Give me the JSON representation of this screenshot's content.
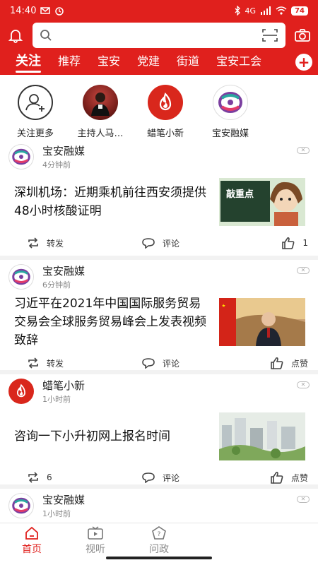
{
  "status_bar": {
    "time": "14:40",
    "network": "4G",
    "battery": "74"
  },
  "search": {
    "placeholder": ""
  },
  "tabs": [
    {
      "label": "关注",
      "active": true
    },
    {
      "label": "推荐"
    },
    {
      "label": "宝安"
    },
    {
      "label": "党建"
    },
    {
      "label": "街道"
    },
    {
      "label": "宝安工会"
    }
  ],
  "follow": [
    {
      "label": "关注更多",
      "icon": "add-user-icon"
    },
    {
      "label": "主持人马…",
      "icon": "host-avatar"
    },
    {
      "label": "蜡笔小新",
      "icon": "fire-icon"
    },
    {
      "label": "宝安融媒",
      "icon": "media-logo-icon"
    }
  ],
  "feed": [
    {
      "author": "宝安融媒",
      "time": "4分钟前",
      "title": "深圳机场：近期乘机前往西安须提供48小时核酸证明",
      "thumb_text": "敲重点",
      "repost_label": "转发",
      "comment_label": "评论",
      "like_value": "1"
    },
    {
      "author": "宝安融媒",
      "time": "6分钟前",
      "title": "习近平在2021年中国国际服务贸易交易会全球服务贸易峰会上发表视频致辞",
      "repost_label": "转发",
      "comment_label": "评论",
      "like_value": "点赞"
    },
    {
      "author": "蜡笔小新",
      "time": "1小时前",
      "title": "咨询一下小升初网上报名时间",
      "repost_label": "6",
      "comment_label": "评论",
      "like_value": "点赞"
    },
    {
      "author": "宝安融媒",
      "time": "1小时前"
    }
  ],
  "bottom_nav": [
    {
      "label": "首页",
      "active": true
    },
    {
      "label": "视听"
    },
    {
      "label": "问政"
    },
    {
      "label": ""
    },
    {
      "label": ""
    }
  ],
  "colors": {
    "brand": "#e0201d"
  }
}
